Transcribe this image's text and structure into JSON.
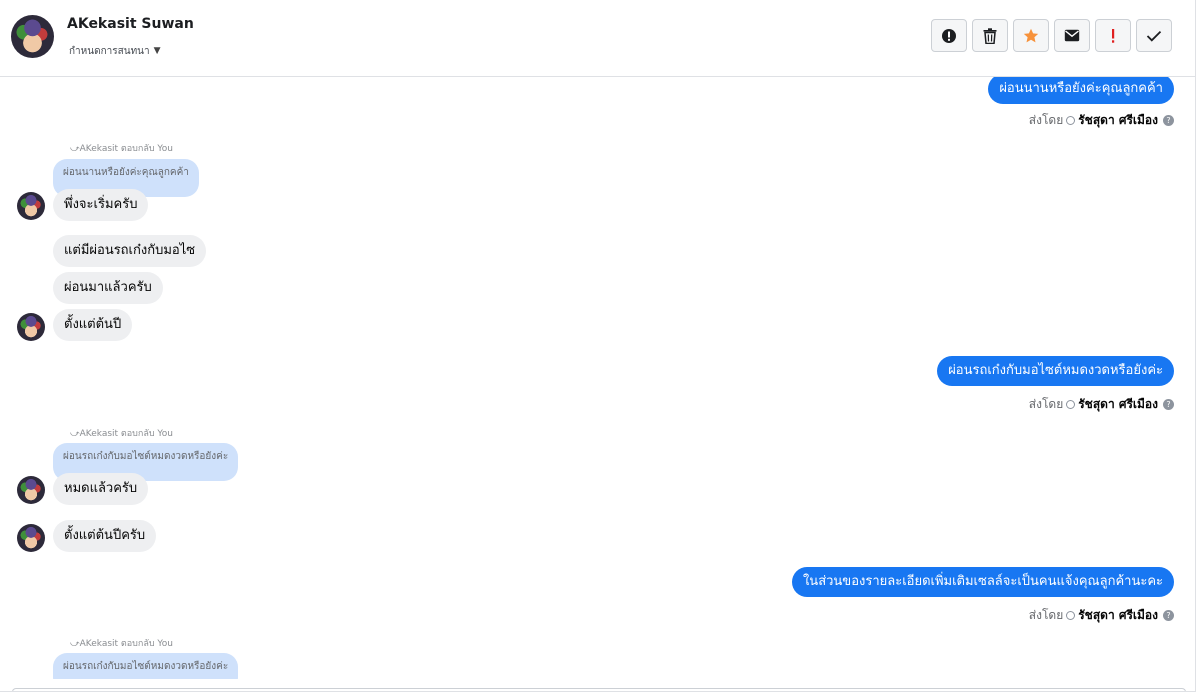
{
  "header": {
    "name": "AKekasit Suwan",
    "subtitle": "กำหนดการสนทนา",
    "avatar_icon": "profile-photo",
    "tools": [
      {
        "name": "spam-icon",
        "color": "#1c1e21"
      },
      {
        "name": "trash-icon",
        "color": "#1c1e21"
      },
      {
        "name": "star-icon",
        "color": "#f7923b"
      },
      {
        "name": "mail-icon",
        "color": "#1c1e21"
      },
      {
        "name": "important-icon",
        "color": "#e02020"
      },
      {
        "name": "check-icon",
        "color": "#1c1e21"
      }
    ]
  },
  "messages": {
    "sent_prefix": "ส่งโดย",
    "sent_by": "รัชสุดา ศรีเมือง",
    "reply_label": "AKekasit ตอบกลับ You",
    "out1": "ผ่อนนานหรือยังค่ะคุณลูกคค้า",
    "quote1": "ผ่อนนานหรือยังค่ะคุณลูกคค้า",
    "in1": "พึ่งจะเริ่มครับ",
    "in2": "แต่มีผ่อนรถเก๋งกับมอไซ",
    "in3": "ผ่อนมาแล้วครับ",
    "in4": "ตั้งแต่ต้นปี",
    "out2": "ผ่อนรถเก๋งกับมอไซต์หมดงวดหรือยังค่ะ",
    "quote2": "ผ่อนรถเก๋งกับมอไซต์หมดงวดหรือยังค่ะ",
    "in5": "หมดแล้วครับ",
    "in6": "ตั้งแต่ต้นปีครับ",
    "out3": "ในส่วนของรายละเอียดเพิ่มเติมเซลล์จะเป็นคนแจ้งคุณลูกค้านะคะ",
    "quote3": "ผ่อนรถเก๋งกับมอไซต์หมดงวดหรือยังค่ะ"
  },
  "colors": {
    "accent": "#1877f2",
    "quote_bg": "#cfe1fb",
    "incoming_bg": "#eeeff1"
  }
}
